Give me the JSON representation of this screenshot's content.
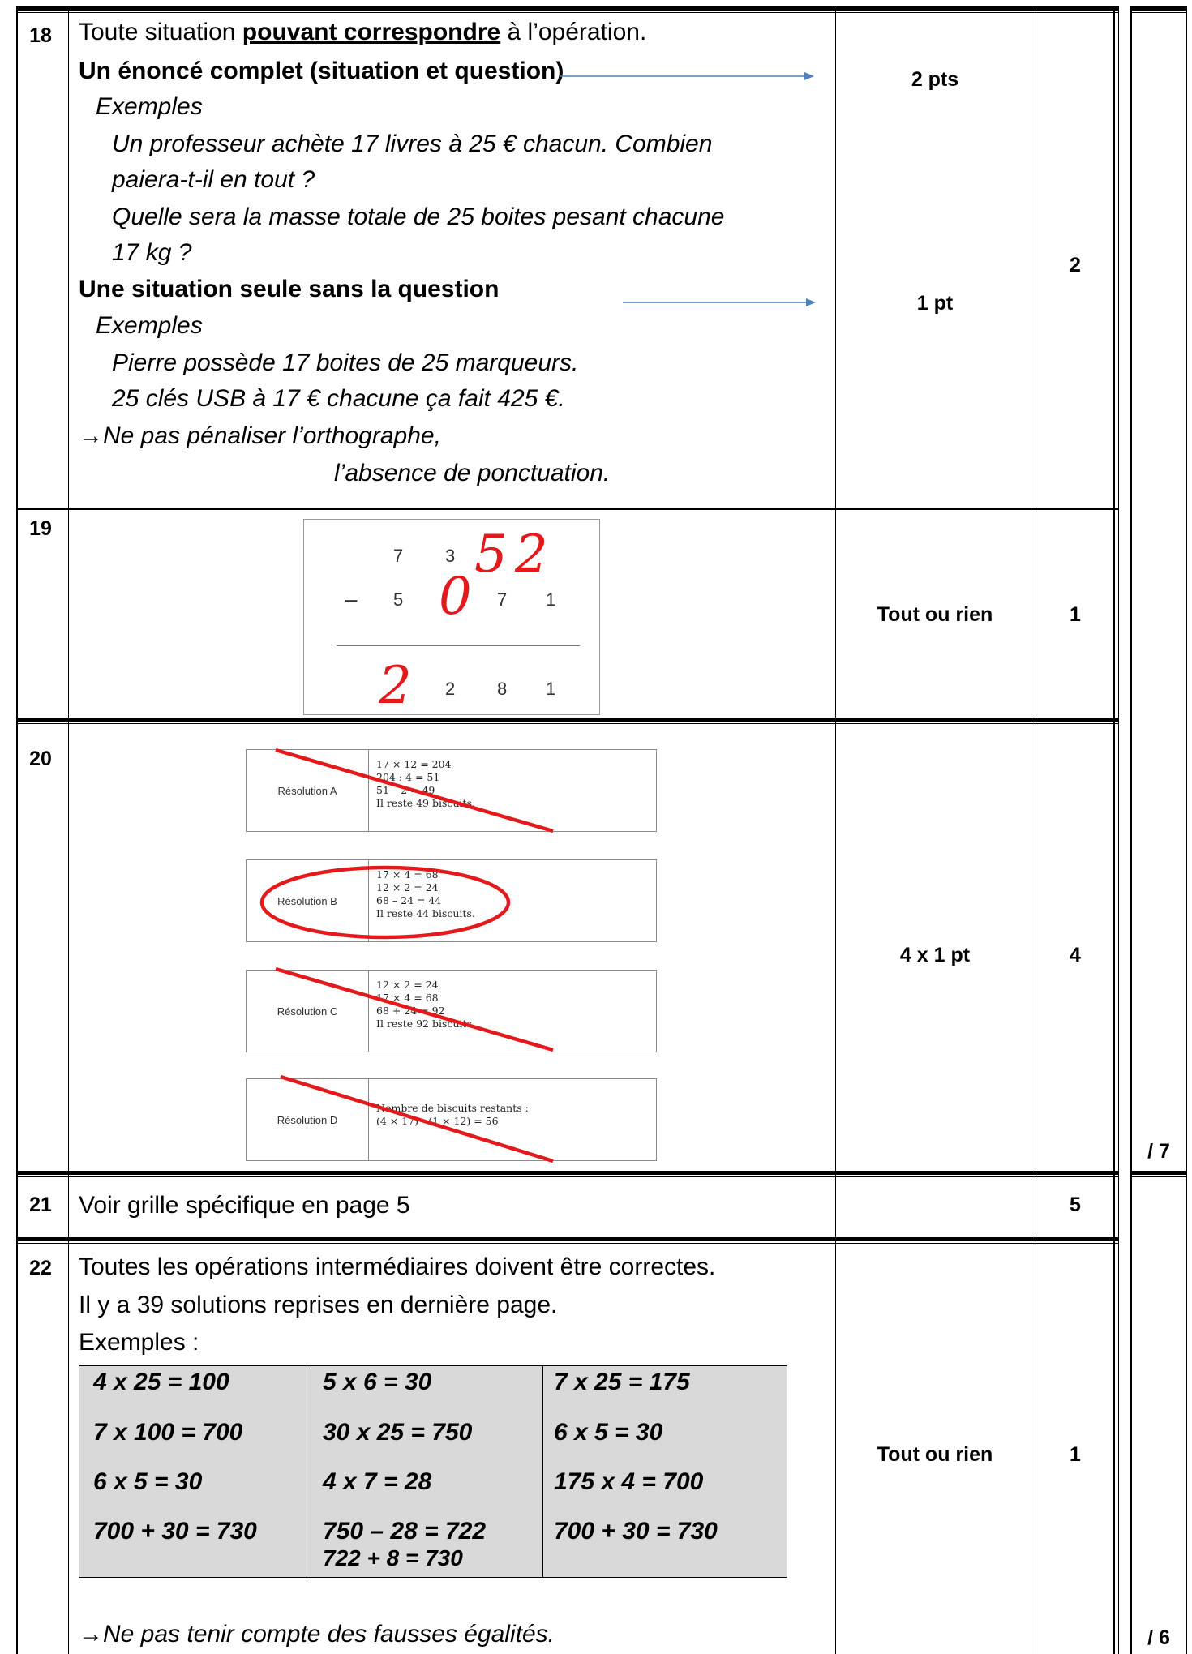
{
  "q18": {
    "number": "18",
    "intro_before": "Toute situation ",
    "intro_bold": "pouvant correspondre",
    "intro_after": " à l’opération.",
    "complete_heading": "Un énoncé complet (situation et question)",
    "examples_label": "Exemples",
    "example_1a": "Un professeur achète 17 livres à 25 € chacun. Combien",
    "example_1b": "paiera-t-il en tout ?",
    "example_2a": "Quelle sera la masse totale de 25 boites pesant chacune",
    "example_2b": "17 kg ?",
    "partial_heading": "Une situation seule sans la question",
    "examples_label_2": "Exemples",
    "example_3": "Pierre possède 17 boites de 25 marqueurs.",
    "example_4": "25 clés USB à 17 € chacune ça fait 425 €.",
    "note_1": "Ne pas pénaliser l’orthographe,",
    "note_2": "l’absence de ponctuation.",
    "arrow_glyph": "→",
    "points_full": "2 pts",
    "points_partial": "1 pt",
    "score": "2"
  },
  "q19": {
    "number": "19",
    "row1": [
      "7",
      "3",
      "5",
      "2"
    ],
    "row2": [
      "5",
      "0",
      "7",
      "1"
    ],
    "row3": [
      "2",
      "2",
      "8",
      "1"
    ],
    "minus": "–",
    "points": "Tout ou rien",
    "score": "1"
  },
  "q20": {
    "number": "20",
    "resolutions": [
      {
        "label": "Résolution A",
        "lines": [
          "17 × 12 = 204",
          "204 : 4 = 51",
          "51 – 2 = 49",
          "Il reste 49 biscuits."
        ]
      },
      {
        "label": "Résolution B",
        "lines": [
          "17 × 4 = 68",
          "12 × 2 = 24",
          "68 – 24 = 44",
          "Il reste 44 biscuits."
        ]
      },
      {
        "label": "Résolution C",
        "lines": [
          "12 × 2 = 24",
          "17 × 4 = 68",
          "68 + 24 = 92",
          "Il reste 92 biscuits."
        ]
      },
      {
        "label": "Résolution D",
        "lines": [
          "Nombre de biscuits restants :",
          "(4 × 17) - (1 × 12) = 56"
        ]
      }
    ],
    "points": "4 x 1 pt",
    "score": "4",
    "subtotal": "/ 7"
  },
  "q21": {
    "number": "21",
    "text": "Voir grille spécifique en page 5",
    "score": "5"
  },
  "q22": {
    "number": "22",
    "line_1": "Toutes les opérations intermédiaires doivent être correctes.",
    "line_2": "Il y a 39 solutions reprises en dernière page.",
    "line_3": "Exemples :",
    "col_1": [
      "4 x 25 = 100",
      "7 x 100 = 700",
      "6 x 5 = 30",
      "700 + 30 = 730"
    ],
    "col_2": [
      "5 x 6 = 30",
      "30 x 25 = 750",
      "4 x 7 = 28",
      "750 – 28 = 722",
      "722 + 8 = 730"
    ],
    "col_3": [
      "7 x 25 = 175",
      "6 x 5 = 30",
      "175 x 4 = 700",
      "700 + 30 = 730"
    ],
    "note": "Ne pas tenir compte des fausses égalités.",
    "arrow_glyph": "→",
    "points": "Tout ou rien",
    "score": "1",
    "subtotal": "/ 6"
  },
  "colors": {
    "ink": "#000000",
    "correction_red": "#e3191c",
    "arrow_blue": "#4f81bd",
    "table_fill": "#d9d9d9"
  }
}
